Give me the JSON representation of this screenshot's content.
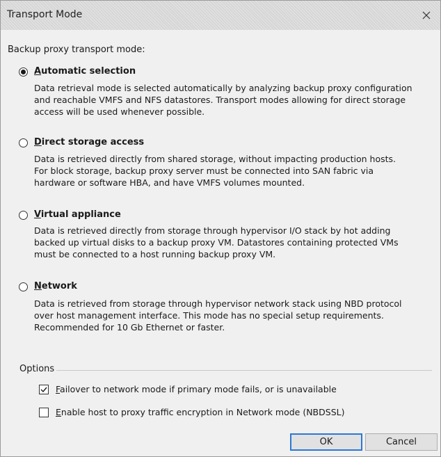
{
  "window": {
    "title": "Transport Mode"
  },
  "transport": {
    "heading": "Backup proxy transport mode:",
    "modes": [
      {
        "accesskey": "A",
        "label_rest": "utomatic selection",
        "selected": true,
        "desc_lines": [
          "Data retrieval mode is selected automatically by analyzing backup proxy configuration",
          "and reachable VMFS and NFS datastores. Transport modes allowing for direct storage",
          "access will be used whenever possible."
        ]
      },
      {
        "accesskey": "D",
        "label_rest": "irect storage access",
        "selected": false,
        "desc_lines": [
          "Data is retrieved directly from shared storage, without impacting production hosts.",
          "For block storage, backup proxy server must be connected into SAN fabric via",
          "hardware or software HBA, and have VMFS volumes mounted."
        ]
      },
      {
        "accesskey": "V",
        "label_rest": "irtual appliance",
        "selected": false,
        "desc_lines": [
          "Data is retrieved directly from storage through hypervisor I/O stack by hot adding",
          "backed up virtual disks to a backup proxy VM. Datastores containing protected VMs",
          "must be connected to a host running backup proxy VM."
        ]
      },
      {
        "accesskey": "N",
        "label_rest": "etwork",
        "selected": false,
        "desc_lines": [
          "Data is retrieved from storage through hypervisor network stack using NBD protocol",
          "over host management interface. This mode has no special setup requirements.",
          "Recommended for 10 Gb Ethernet or faster."
        ]
      }
    ]
  },
  "options": {
    "label": "Options",
    "failover": {
      "accesskey": "F",
      "label_rest": "ailover to network mode if primary mode fails, or is unavailable",
      "checked": true
    },
    "encryption": {
      "accesskey": "E",
      "label_rest": "nable host to proxy traffic encryption in Network mode (NBDSSL)",
      "checked": false
    }
  },
  "buttons": {
    "ok": "OK",
    "cancel": "Cancel"
  },
  "colors": {
    "default_button_border": "#2b78d4",
    "dialog_background": "#f0f0f0"
  }
}
